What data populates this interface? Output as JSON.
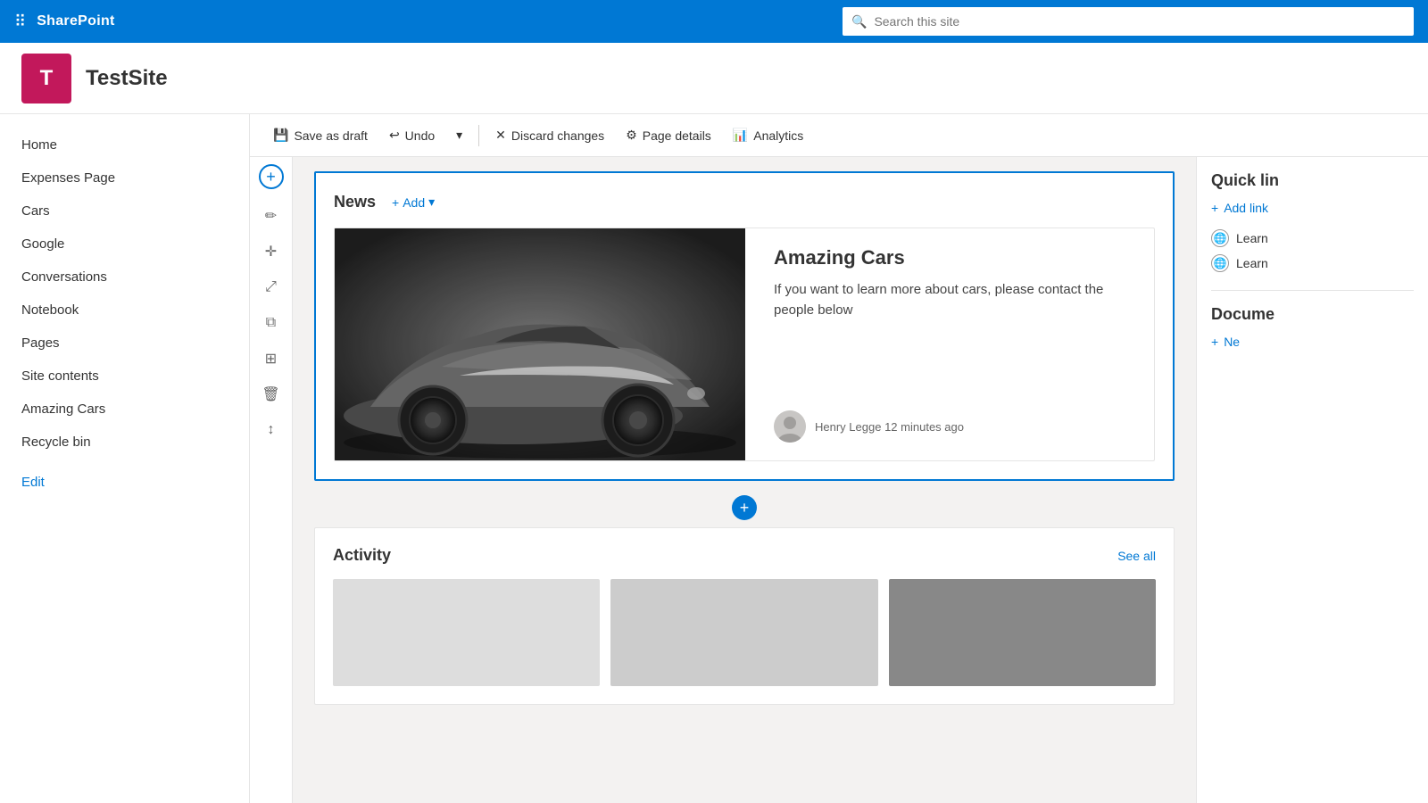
{
  "topbar": {
    "brand": "SharePoint",
    "search_placeholder": "Search this site"
  },
  "site": {
    "logo_letter": "T",
    "title": "TestSite"
  },
  "sidebar": {
    "items": [
      {
        "label": "Home",
        "id": "home"
      },
      {
        "label": "Expenses Page",
        "id": "expenses-page"
      },
      {
        "label": "Cars",
        "id": "cars"
      },
      {
        "label": "Google",
        "id": "google"
      },
      {
        "label": "Conversations",
        "id": "conversations"
      },
      {
        "label": "Notebook",
        "id": "notebook"
      },
      {
        "label": "Pages",
        "id": "pages"
      },
      {
        "label": "Site contents",
        "id": "site-contents"
      },
      {
        "label": "Amazing Cars",
        "id": "amazing-cars"
      },
      {
        "label": "Recycle bin",
        "id": "recycle-bin"
      },
      {
        "label": "Edit",
        "id": "edit",
        "is_edit": true
      }
    ]
  },
  "toolbar": {
    "save_draft_label": "Save as draft",
    "undo_label": "Undo",
    "discard_label": "Discard changes",
    "page_details_label": "Page details",
    "analytics_label": "Analytics"
  },
  "news_section": {
    "heading": "News",
    "add_label": "Add",
    "card": {
      "title": "Amazing Cars",
      "description": "If you want to learn more about cars, please contact the people below",
      "author": "Henry Legge",
      "time_ago": "12 minutes ago"
    }
  },
  "activity_section": {
    "heading": "Activity",
    "see_all_label": "See all"
  },
  "right_panel": {
    "quick_links_title": "Quick lin",
    "add_link_label": "Add link",
    "learn_items": [
      {
        "label": "Learn"
      },
      {
        "label": "Learn"
      }
    ],
    "documents_title": "Docume",
    "new_label": "Ne"
  }
}
